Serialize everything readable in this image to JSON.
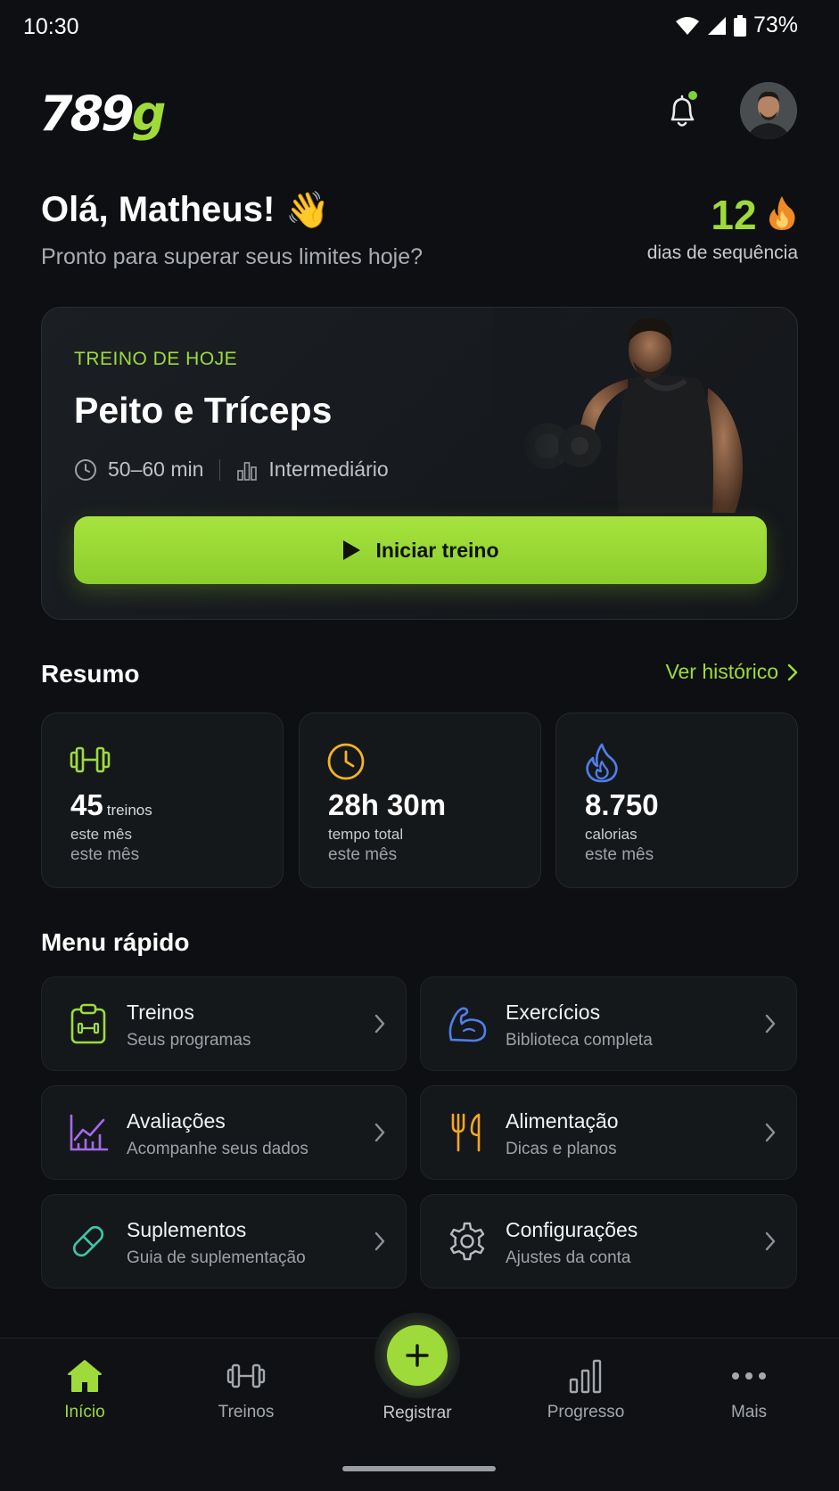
{
  "status_bar": {
    "time": "10:30",
    "battery": "73%"
  },
  "header": {
    "logo_number": "789",
    "logo_letter": "g",
    "notification_icon": "bell-icon",
    "has_notification": true
  },
  "greeting": {
    "title": "Olá, Matheus!",
    "emoji": "👋",
    "subtitle": "Pronto para superar seus limites hoje?"
  },
  "streak": {
    "value": "12",
    "label": "dias de sequência",
    "icon": "flame-icon"
  },
  "today_workout": {
    "eyebrow": "TREINO DE HOJE",
    "title": "Peito e Tríceps",
    "duration": "50–60 min",
    "level": "Intermediário",
    "start_label": "Iniciar treino"
  },
  "summary": {
    "title": "Resumo",
    "history_label": "Ver histórico",
    "cards": [
      {
        "icon": "dumbbell-icon",
        "value": "45",
        "inline_unit": "treinos",
        "unit": "este mês",
        "period": "este mês",
        "color": "#9edb3a"
      },
      {
        "icon": "clock-icon",
        "value": "28h 30m",
        "inline_unit": "",
        "unit": "tempo total",
        "period": "este mês",
        "color": "#f5b323"
      },
      {
        "icon": "flame-icon",
        "value": "8.750",
        "inline_unit": "",
        "unit": "calorias",
        "period": "este mês",
        "color": "#4f7fe8"
      }
    ]
  },
  "quick_menu": {
    "title": "Menu rápido",
    "items": [
      {
        "icon": "clipboard-dumbbell-icon",
        "title": "Treinos",
        "subtitle": "Seus programas",
        "color": "#9edb3a"
      },
      {
        "icon": "bicep-icon",
        "title": "Exercícios",
        "subtitle": "Biblioteca completa",
        "color": "#4f7fe8"
      },
      {
        "icon": "chart-icon",
        "title": "Avaliações",
        "subtitle": "Acompanhe seus dados",
        "color": "#a46be8"
      },
      {
        "icon": "fork-knife-icon",
        "title": "Alimentação",
        "subtitle": "Dicas e planos",
        "color": "#f5a623"
      },
      {
        "icon": "pill-icon",
        "title": "Suplementos",
        "subtitle": "Guia de suplementação",
        "color": "#3fc6a8"
      },
      {
        "icon": "gear-icon",
        "title": "Configurações",
        "subtitle": "Ajustes da conta",
        "color": "#b9bcc0"
      }
    ]
  },
  "bottom_nav": {
    "items": [
      {
        "icon": "home-icon",
        "label": "Início",
        "active": true
      },
      {
        "icon": "dumbbell-icon",
        "label": "Treinos",
        "active": false
      },
      {
        "icon": "plus-icon",
        "label": "Registrar",
        "active": false
      },
      {
        "icon": "bar-chart-icon",
        "label": "Progresso",
        "active": false
      },
      {
        "icon": "more-icon",
        "label": "Mais",
        "active": false
      }
    ]
  }
}
